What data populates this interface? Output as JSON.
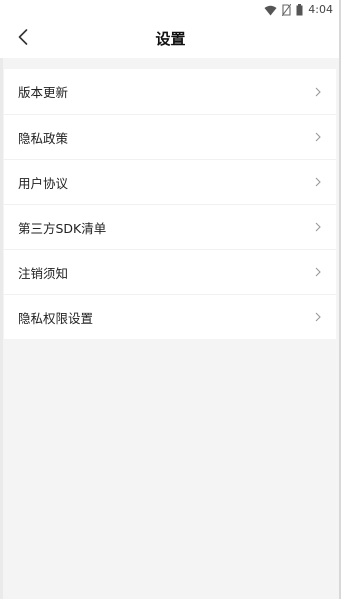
{
  "status_bar": {
    "time": "4:04",
    "icons": [
      "wifi-icon",
      "no-sim-icon",
      "battery-icon"
    ]
  },
  "header": {
    "title": "设置",
    "back_icon": "chevron-left-icon"
  },
  "menu": {
    "items": [
      {
        "label": "版本更新",
        "icon": "chevron-right-icon"
      },
      {
        "label": "隐私政策",
        "icon": "chevron-right-icon"
      },
      {
        "label": "用户协议",
        "icon": "chevron-right-icon"
      },
      {
        "label": "第三方SDK清单",
        "icon": "chevron-right-icon"
      },
      {
        "label": "注销须知",
        "icon": "chevron-right-icon"
      },
      {
        "label": "隐私权限设置",
        "icon": "chevron-right-icon"
      }
    ]
  },
  "colors": {
    "background": "#f4f4f4",
    "surface": "#ffffff",
    "text": "#222222",
    "chevron": "#9a9a9a"
  }
}
